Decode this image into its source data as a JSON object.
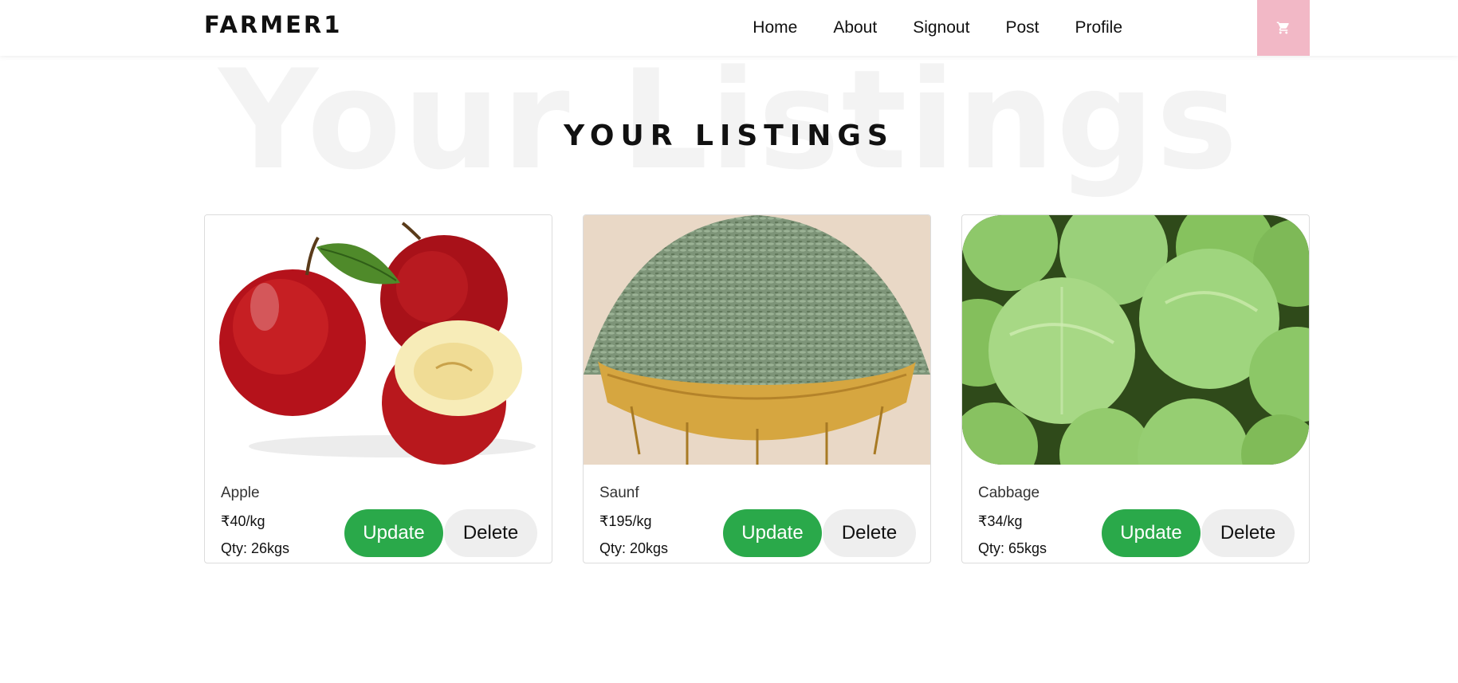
{
  "navbar": {
    "brand": "FARMER1",
    "links": [
      "Home",
      "About",
      "Signout",
      "Post",
      "Profile"
    ],
    "cart_icon": "shopping-cart-icon",
    "cart_color": "#f2b8c6"
  },
  "hero": {
    "background_text": "Your Listings",
    "title": "YOUR LISTINGS"
  },
  "listings": [
    {
      "name": "Apple",
      "price": "₹40/kg",
      "qty": "Qty: 26kgs",
      "image": "apple-image",
      "update_label": "Update",
      "delete_label": "Delete"
    },
    {
      "name": "Saunf",
      "price": "₹195/kg",
      "qty": "Qty: 20kgs",
      "image": "saunf-image",
      "update_label": "Update",
      "delete_label": "Delete"
    },
    {
      "name": "Cabbage",
      "price": "₹34/kg",
      "qty": "Qty: 65kgs",
      "image": "cabbage-image",
      "update_label": "Update",
      "delete_label": "Delete"
    }
  ],
  "colors": {
    "update_button": "#2aa94a",
    "delete_button": "#eeeeee"
  }
}
